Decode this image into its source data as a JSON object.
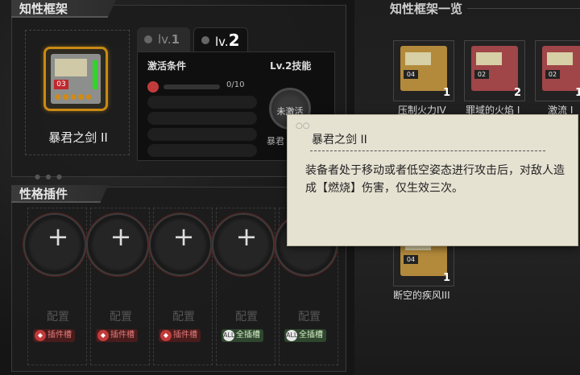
{
  "framework_panel": {
    "title": "知性框架",
    "equipped": {
      "name": "暴君之剑 II",
      "level_badge": "03"
    },
    "tabs": [
      {
        "prefix": "lv.",
        "number": "1"
      },
      {
        "prefix": "lv.",
        "number": "2"
      }
    ],
    "condition_label": "激活条件",
    "progress_text": "0/10",
    "skill_label": "Lv.2技能",
    "skill_status": "未激活",
    "skill_name_partial": "暴君"
  },
  "plugin_panel": {
    "title": "性格插件",
    "slots": [
      {
        "label": "配置",
        "type": "插件槽",
        "type_icon": "flame-icon",
        "kind": "red"
      },
      {
        "label": "配置",
        "type": "插件槽",
        "type_icon": "flame-icon",
        "kind": "red"
      },
      {
        "label": "配置",
        "type": "插件槽",
        "type_icon": "flame-icon",
        "kind": "red"
      },
      {
        "label": "配置",
        "type": "全插槽",
        "type_icon": "ALL",
        "kind": "green"
      },
      {
        "label": "配置",
        "type": "全插槽",
        "type_icon": "ALL",
        "kind": "green"
      }
    ]
  },
  "framework_list": {
    "title": "知性框架一览",
    "items": [
      {
        "name": "压制火力IV",
        "badge": "04",
        "count": "1",
        "color": "gold"
      },
      {
        "name": "罪域的火焰 I",
        "badge": "02",
        "count": "2",
        "color": "red"
      },
      {
        "name": "激流 I",
        "badge": "02",
        "count": "1",
        "color": "red"
      },
      {
        "name": "断空的疾风III",
        "badge": "04",
        "count": "1",
        "color": "gold"
      }
    ]
  },
  "tooltip": {
    "title": "暴君之剑 II",
    "description": "装备者处于移动或者低空姿态进行攻击后，对敌人造成【燃烧】伤害，仅生效三次。"
  },
  "colors": {
    "accent_gold": "#c98a14",
    "status_red": "#c23b3b",
    "tooltip_bg": "#e6e2d2"
  }
}
